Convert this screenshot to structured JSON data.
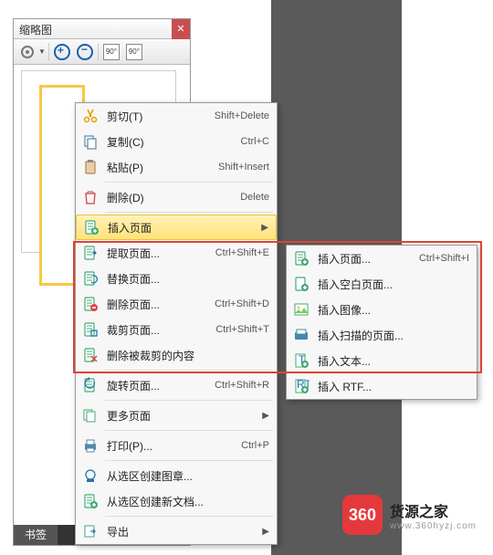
{
  "panel": {
    "title": "缩略图"
  },
  "tabs": {
    "bookmark": "书签"
  },
  "menu": [
    {
      "icon": "cut",
      "label": "剪切(T)",
      "sc": "Shift+Delete"
    },
    {
      "icon": "copy",
      "label": "复制(C)",
      "sc": "Ctrl+C"
    },
    {
      "icon": "paste",
      "label": "粘贴(P)",
      "sc": "Shift+Insert"
    },
    {
      "sep": true
    },
    {
      "icon": "delete",
      "label": "删除(D)",
      "sc": "Delete"
    },
    {
      "sep": true
    },
    {
      "icon": "insert",
      "label": "插入页面",
      "sub": true,
      "hover": true
    },
    {
      "icon": "extract",
      "label": "提取页面...",
      "sc": "Ctrl+Shift+E"
    },
    {
      "icon": "replace",
      "label": "替换页面..."
    },
    {
      "icon": "delpage",
      "label": "删除页面...",
      "sc": "Ctrl+Shift+D"
    },
    {
      "icon": "crop",
      "label": "裁剪页面...",
      "sc": "Ctrl+Shift+T"
    },
    {
      "icon": "delcrop",
      "label": "删除被裁剪的内容"
    },
    {
      "sep": true
    },
    {
      "icon": "rotate",
      "label": "旋转页面...",
      "sc": "Ctrl+Shift+R"
    },
    {
      "sep": true
    },
    {
      "icon": "more",
      "label": "更多页面",
      "sub": true
    },
    {
      "sep": true
    },
    {
      "icon": "print",
      "label": "打印(P)...",
      "sc": "Ctrl+P"
    },
    {
      "sep": true
    },
    {
      "icon": "stamp",
      "label": "从选区创建图章..."
    },
    {
      "icon": "newdoc",
      "label": "从选区创建新文档..."
    },
    {
      "sep": true
    },
    {
      "icon": "export",
      "label": "导出",
      "sub": true
    }
  ],
  "submenu": [
    {
      "icon": "insert",
      "label": "插入页面...",
      "sc": "Ctrl+Shift+I"
    },
    {
      "icon": "blank",
      "label": "插入空白页面..."
    },
    {
      "icon": "image",
      "label": "插入图像..."
    },
    {
      "icon": "scan",
      "label": "插入扫描的页面..."
    },
    {
      "icon": "text",
      "label": "插入文本..."
    },
    {
      "icon": "rtf",
      "label": "插入 RTF..."
    }
  ],
  "logo": {
    "badge": "360",
    "cn": "货源之家",
    "en": "www.360hyzj.com"
  }
}
